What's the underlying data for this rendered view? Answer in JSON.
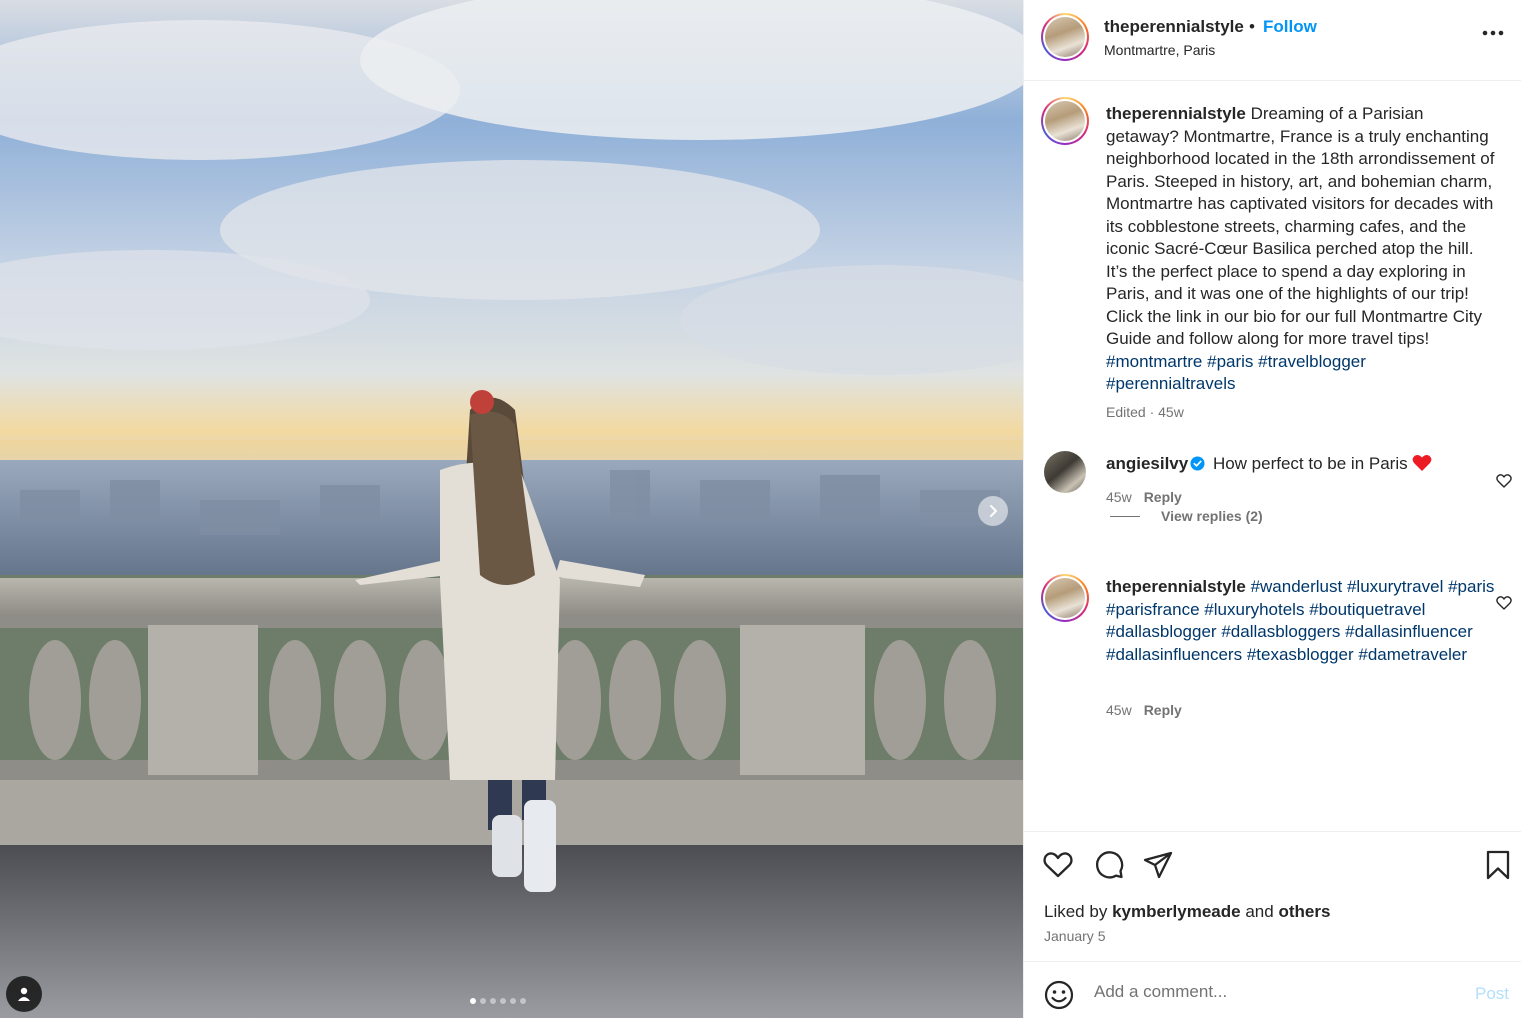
{
  "post": {
    "username": "theperennialstyle",
    "separator": "•",
    "follow_label": "Follow",
    "location": "Montmartre, Paris",
    "more_icon": "more-horizontal-icon"
  },
  "media": {
    "description_icon": "photo-carousel",
    "next_icon": "chevron-right-icon",
    "tagged_icon": "user-tag-icon",
    "slide_count": 6,
    "active_slide": 1
  },
  "caption": {
    "username": "theperennialstyle",
    "text": "Dreaming of a Parisian getaway? Montmartre, France is a truly enchanting neighborhood located in the 18th arrondissement of Paris. Steeped in history, art, and bohemian charm, Montmartre has captivated visitors for decades with its cobblestone streets, charming cafes, and the iconic Sacré-Cœur Basilica perched atop the hill. It’s the perfect place to spend a day exploring in Paris, and it was one of the highlights of our trip! Click the link in our bio for our full Montmartre City Guide and follow along for more travel tips!",
    "hashtags": [
      "#montmartre",
      "#paris",
      "#travelblogger",
      "#perennialtravels"
    ],
    "meta": "Edited · 45w"
  },
  "comments": [
    {
      "username": "angiesilvy",
      "verified": true,
      "text": "How perfect to be in Paris",
      "emoji": "❤️",
      "time": "45w",
      "reply_label": "Reply",
      "view_replies": "View replies (2)"
    },
    {
      "username": "theperennialstyle",
      "hashtags_line1": [
        "#wanderlust",
        "#luxurytravel"
      ],
      "hashtags_line2": [
        "#paris",
        "#parisfrance",
        "#luxuryhotels"
      ],
      "hashtags_line3": [
        "#boutiquetravel",
        "#dallasblogger",
        "#dallasbloggers"
      ],
      "hashtags_line4": [
        "#dallasinfluencer",
        "#dallasinfluencers"
      ],
      "hashtags_line5": [
        "#texasblogger",
        "#dametraveler"
      ],
      "time": "45w",
      "reply_label": "Reply"
    }
  ],
  "actions": {
    "like_icon": "heart-icon",
    "comment_icon": "comment-icon",
    "share_icon": "share-icon",
    "save_icon": "bookmark-icon"
  },
  "likes": {
    "prefix": "Liked by",
    "user": "kymberlymeade",
    "and": "and",
    "others": "others"
  },
  "date": "January 5",
  "add_comment": {
    "placeholder": "Add a comment...",
    "post_label": "Post",
    "emoji_icon": "emoji-icon"
  },
  "colors": {
    "link_blue": "#0095f6",
    "hashtag": "#00376b",
    "muted": "#737373",
    "post_disabled": "#b2dffc",
    "heart_red": "#ed1c24"
  }
}
